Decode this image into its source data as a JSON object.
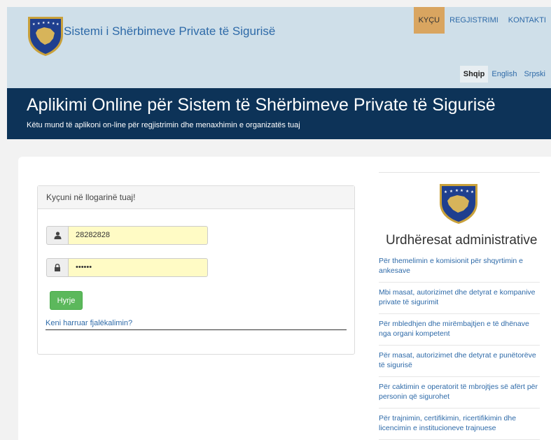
{
  "header": {
    "site_title": "Sistemi i Shërbimeve Private të Sigurisë",
    "nav": [
      {
        "label": "KYÇU"
      },
      {
        "label": "REGJISTRIMI"
      },
      {
        "label": "KONTAKTI"
      }
    ],
    "languages": [
      {
        "label": "Shqip"
      },
      {
        "label": "English"
      },
      {
        "label": "Srpski"
      }
    ]
  },
  "banner": {
    "title": "Aplikimi Online për Sistem të Shërbimeve Private të Sigurisë",
    "subtitle": "Këtu mund të aplikoni on-line për regjistrimin dhe menaxhimin e organizatës tuaj"
  },
  "login": {
    "heading": "Kyçuni në llogarinë tuaj!",
    "username_value": "28282828",
    "password_value": "••••••",
    "submit_label": "Hyrje",
    "forgot_label": "Keni harruar fjalëkalimin?"
  },
  "sidebar": {
    "title": "Urdhëresat administrative",
    "links": [
      {
        "label": "Për themelimin e komisionit për shqyrtimin e ankesave"
      },
      {
        "label": "Mbi masat, autorizimet dhe detyrat e kompanive private të sigurimit"
      },
      {
        "label": "Për mbledhjen dhe mirëmbajtjen e të dhënave nga organi kompetent"
      },
      {
        "label": "Për masat, autorizimet dhe detyrat e punëtorëve të sigurisë"
      },
      {
        "label": "Për caktimin e operatorit të mbrojtjes së afërt për personin që sigurohet"
      },
      {
        "label": "Për trajnimin, certifikimin, ricertifikimin dhe licencimin e institucioneve trajnuese"
      }
    ]
  },
  "colors": {
    "header_bg": "#cfdfe9",
    "banner_bg": "#0d3358",
    "active_nav": "#d9a560",
    "link": "#2e6aa8",
    "input_bg": "#fffbc5",
    "button_green": "#5cb85c"
  },
  "icons": {
    "emblem": "kosovo-coat-of-arms",
    "username": "user-icon",
    "password": "lock-icon"
  }
}
